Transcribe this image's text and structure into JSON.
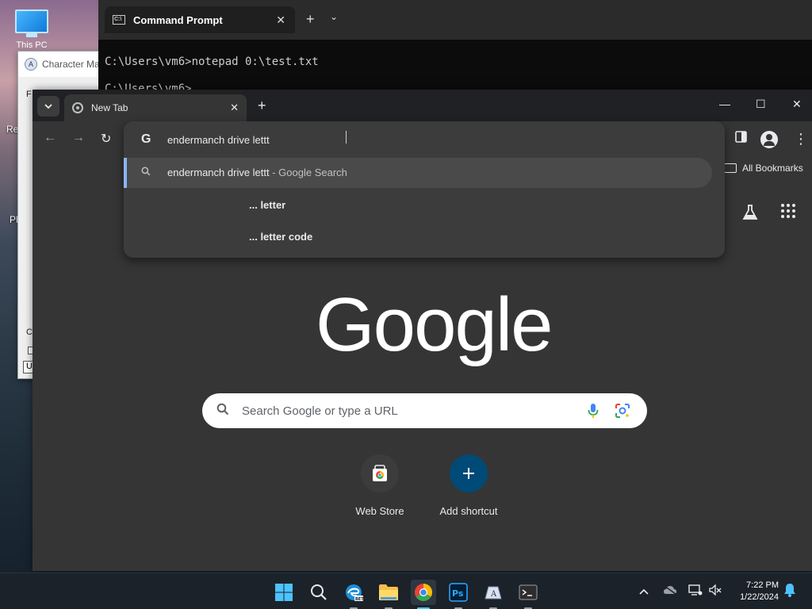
{
  "desktop": {
    "icons": [
      {
        "label": "This PC"
      }
    ],
    "partial_labels": [
      "Re",
      "Ph"
    ]
  },
  "character_map": {
    "title": "Character Ma",
    "fragments": [
      "F",
      "C",
      "U"
    ]
  },
  "terminal": {
    "tab_title": "Command Prompt",
    "close": "✕",
    "new_tab": "+",
    "dropdown": "⌄",
    "line1": "C:\\Users\\vm6>notepad 0:\\test.txt",
    "line2": "C:\\Users\\vm6>"
  },
  "chrome": {
    "tab_search_icon": "chevron-down",
    "tab": {
      "title": "New Tab",
      "close": "✕"
    },
    "new_tab": "+",
    "window_buttons": {
      "minimize": "—",
      "maximize": "☐",
      "close": "✕"
    },
    "nav": {
      "back": "←",
      "forward": "→",
      "reload": "↻"
    },
    "omnibox": {
      "text": "endermanch drive lettt",
      "suggestions": [
        {
          "main": "endermanch drive lettt",
          "sub": " - Google Search"
        },
        {
          "main": "... letter"
        },
        {
          "main": "... letter code"
        }
      ]
    },
    "bookmarks": {
      "label": "All Bookmarks"
    },
    "ntp": {
      "logo": "Google",
      "search_placeholder": "Search Google or type a URL",
      "shortcuts": [
        {
          "label": "Web Store"
        },
        {
          "label": "Add shortcut"
        }
      ]
    }
  },
  "taskbar": {
    "apps": [
      "start",
      "search",
      "edge-beta",
      "file-explorer",
      "chrome",
      "photoshop",
      "character-map",
      "terminal"
    ],
    "clock": {
      "time": "7:22 PM",
      "date": "1/22/2024"
    }
  },
  "colors": {
    "chrome_bg": "#353535",
    "accent": "#8ab4f8",
    "add_shortcut": "#1a73e8",
    "taskbar_active": "#4cc2ff"
  }
}
